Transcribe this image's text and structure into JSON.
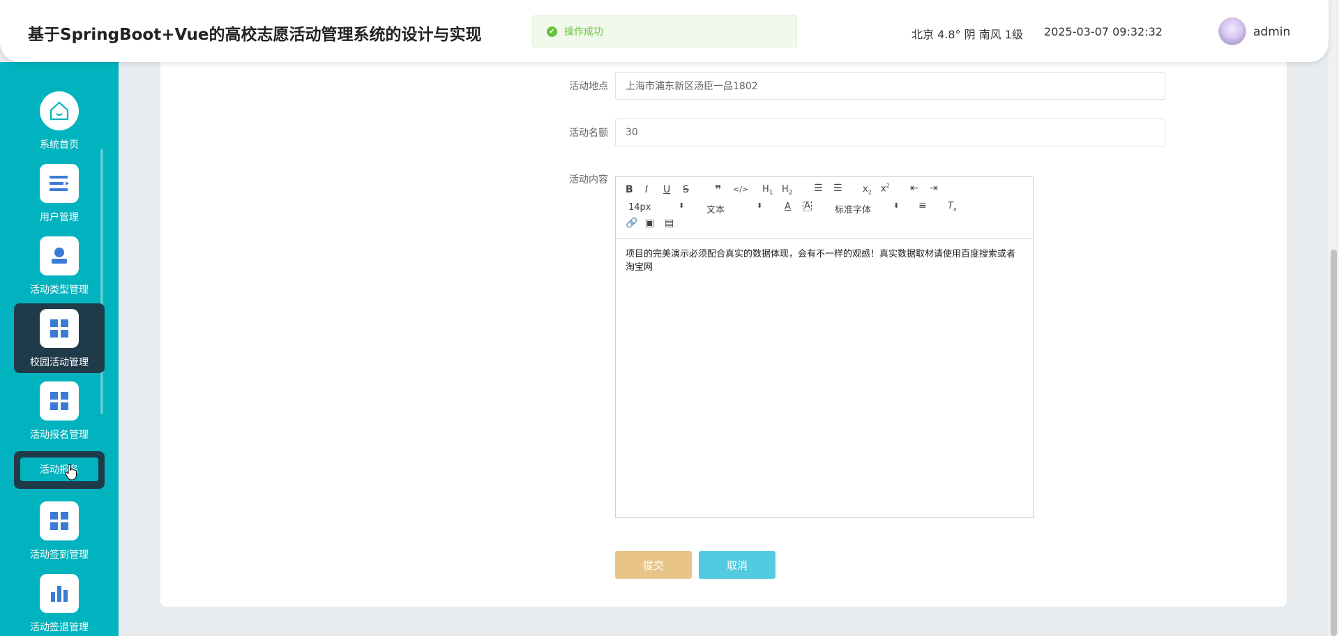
{
  "header": {
    "title": "基于SpringBoot+Vue的高校志愿活动管理系统的设计与实现",
    "weather": "北京  4.8°  阴  南风  1级",
    "datetime": "2025-03-07 09:32:32",
    "username": "admin"
  },
  "toast": {
    "message": "操作成功",
    "color": "#67c23a"
  },
  "sidebar": {
    "items": [
      {
        "label": "系统首页",
        "icon": "home-icon"
      },
      {
        "label": "用户管理",
        "icon": "list-icon"
      },
      {
        "label": "活动类型管理",
        "icon": "user-icon"
      },
      {
        "label": "校园活动管理",
        "icon": "grid-icon"
      },
      {
        "label": "活动报名管理",
        "icon": "grid-icon"
      },
      {
        "label": "活动签到管理",
        "icon": "grid-icon"
      },
      {
        "label": "活动签退管理",
        "icon": "bar-chart-icon"
      }
    ],
    "submenu": {
      "label": "活动报名"
    },
    "accent": "#00b3be"
  },
  "form": {
    "location_label": "活动地点",
    "location_value": "上海市浦东新区汤臣一品1802",
    "quota_label": "活动名额",
    "quota_value": "30",
    "content_label": "活动内容",
    "content_value": "项目的完美演示必须配合真实的数据体现，会有不一样的观感！真实数据取材请使用百度搜索或者淘宝网"
  },
  "editor": {
    "font_size": "14px",
    "header_select": "文本",
    "font_family": "标准字体"
  },
  "buttons": {
    "submit": "提交",
    "cancel": "取消"
  }
}
